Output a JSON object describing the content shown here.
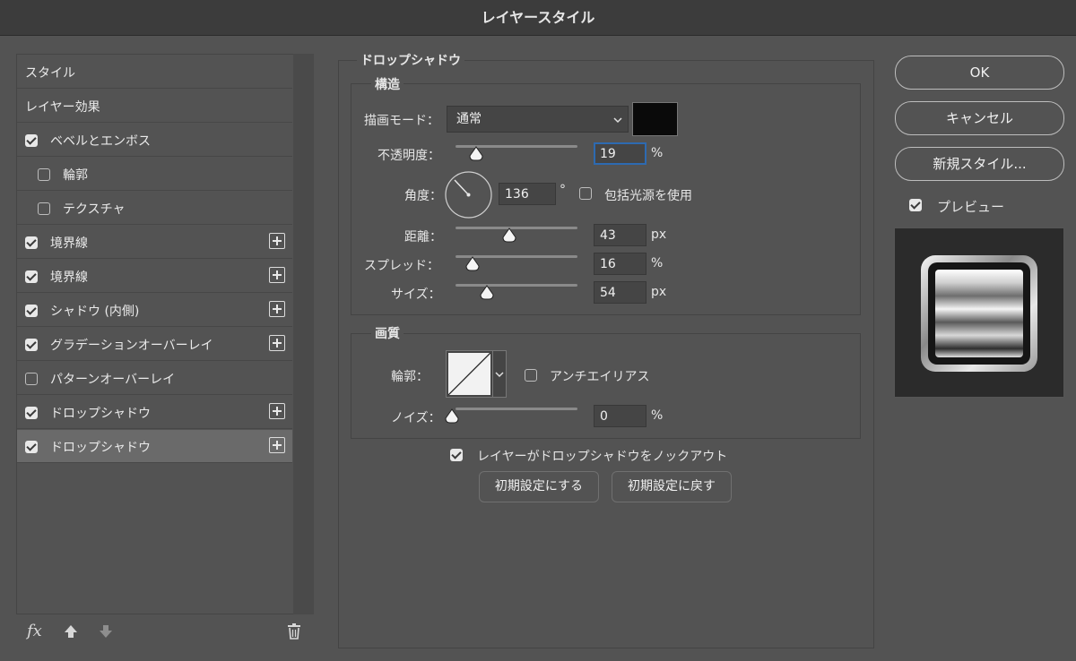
{
  "window": {
    "title": "レイヤースタイル"
  },
  "sidebar": {
    "items": [
      {
        "label": "スタイル",
        "checkbox": null,
        "plus": false,
        "indent": false,
        "selected": false
      },
      {
        "label": "レイヤー効果",
        "checkbox": null,
        "plus": false,
        "indent": false,
        "selected": false
      },
      {
        "label": "ベベルとエンボス",
        "checkbox": true,
        "plus": false,
        "indent": false,
        "selected": false
      },
      {
        "label": "輪郭",
        "checkbox": false,
        "plus": false,
        "indent": true,
        "selected": false
      },
      {
        "label": "テクスチャ",
        "checkbox": false,
        "plus": false,
        "indent": true,
        "selected": false
      },
      {
        "label": "境界線",
        "checkbox": true,
        "plus": true,
        "indent": false,
        "selected": false
      },
      {
        "label": "境界線",
        "checkbox": true,
        "plus": true,
        "indent": false,
        "selected": false
      },
      {
        "label": "シャドウ (内側)",
        "checkbox": true,
        "plus": true,
        "indent": false,
        "selected": false
      },
      {
        "label": "グラデーションオーバーレイ",
        "checkbox": true,
        "plus": true,
        "indent": false,
        "selected": false
      },
      {
        "label": "パターンオーバーレイ",
        "checkbox": false,
        "plus": false,
        "indent": false,
        "selected": false
      },
      {
        "label": "ドロップシャドウ",
        "checkbox": true,
        "plus": true,
        "indent": false,
        "selected": false
      },
      {
        "label": "ドロップシャドウ",
        "checkbox": true,
        "plus": true,
        "indent": false,
        "selected": true
      }
    ],
    "footer": {
      "fx_label": "fx"
    }
  },
  "main": {
    "section_title": "ドロップシャドウ",
    "structure": {
      "title": "構造",
      "blend_mode_label": "描画モード：",
      "blend_mode_value": "通常",
      "shadow_color": "#0a0a0a",
      "opacity_label": "不透明度：",
      "opacity_value": "19",
      "opacity_unit": "%",
      "angle_label": "角度：",
      "angle_value": "136",
      "angle_unit": "°",
      "global_light_label": "包括光源を使用",
      "global_light_checked": false,
      "distance_label": "距離：",
      "distance_value": "43",
      "distance_unit": "px",
      "spread_label": "スプレッド：",
      "spread_value": "16",
      "spread_unit": "%",
      "size_label": "サイズ：",
      "size_value": "54",
      "size_unit": "px"
    },
    "quality": {
      "title": "画質",
      "contour_label": "輪郭：",
      "antialias_label": "アンチエイリアス",
      "antialias_checked": false,
      "noise_label": "ノイズ：",
      "noise_value": "0",
      "noise_unit": "%"
    },
    "knockout_label": "レイヤーがドロップシャドウをノックアウト",
    "knockout_checked": true,
    "make_default_label": "初期設定にする",
    "reset_default_label": "初期設定に戻す"
  },
  "right": {
    "ok_label": "OK",
    "cancel_label": "キャンセル",
    "new_style_label": "新規スタイル...",
    "preview_label": "プレビュー",
    "preview_checked": true
  }
}
